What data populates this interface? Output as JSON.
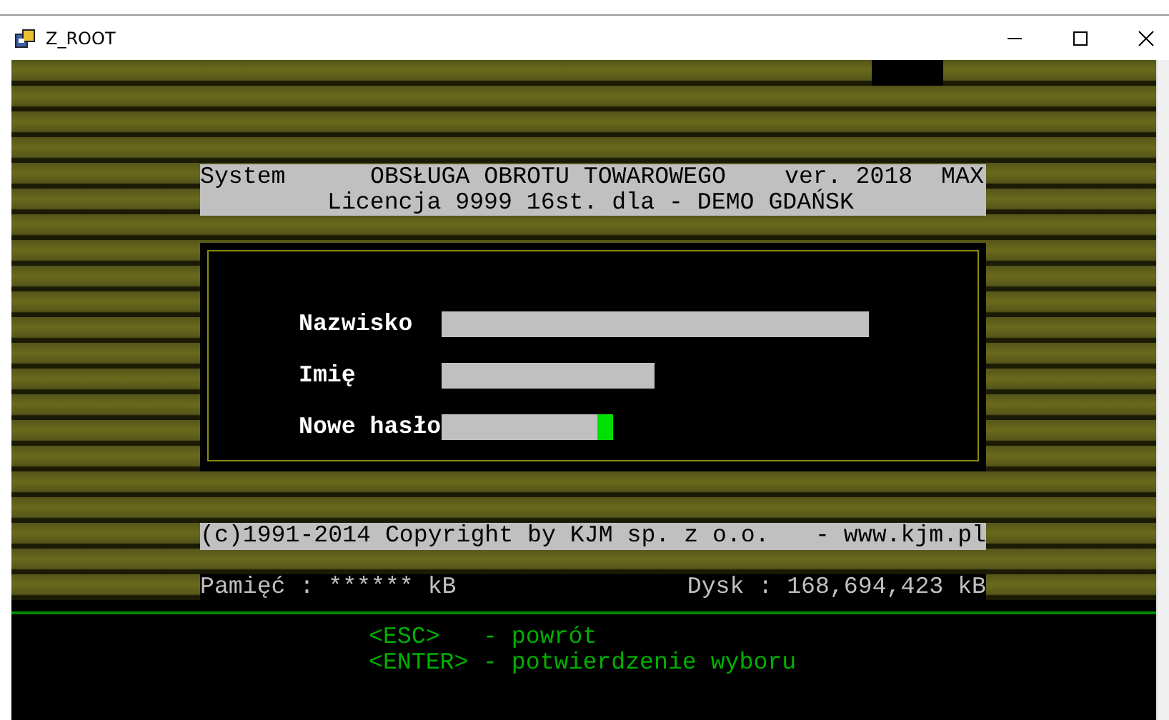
{
  "window": {
    "title": "Z_ROOT"
  },
  "header": {
    "system": "System",
    "title": "OBSŁUGA OBROTU TOWAROWEGO",
    "version": "ver. 2018  MAX",
    "license": "Licencja 9999 16st. dla - DEMO GDAŃSK"
  },
  "login": {
    "fields": [
      {
        "label": "Nazwisko",
        "focused": false
      },
      {
        "label": "Imię",
        "focused": false
      },
      {
        "label": "Nowe hasło",
        "focused": true
      }
    ]
  },
  "copyright": {
    "text": "(c)1991-2014 Copyright by KJM sp. z o.o.",
    "website": "- www.kjm.pl"
  },
  "status_bar": {
    "memory": "Pamięć : ****** kB",
    "disk": "Dysk : 168,694,423 kB"
  },
  "help": [
    {
      "key": "<ESC>",
      "description": "- powrót"
    },
    {
      "key": "<ENTER>",
      "description": "- potwierdzenie wyboru"
    }
  ]
}
